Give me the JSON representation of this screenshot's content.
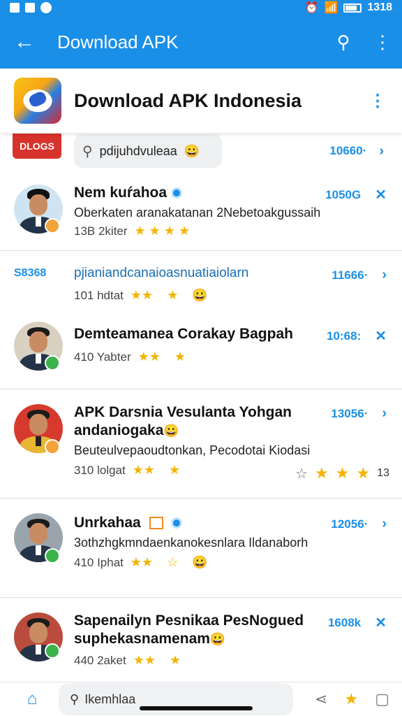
{
  "status_bar": {
    "time": "1318"
  },
  "app_bar": {
    "title": "Download APK"
  },
  "header": {
    "app_name": "Download APK Indonesia"
  },
  "search": {
    "badge": "DLOGS",
    "query": "pdijuhdvuleaa",
    "emoji": "😀",
    "time": "10660·"
  },
  "chats": [
    {
      "title": "Nem kuŕahoa",
      "time": "1050G",
      "subtitle": "Oberkaten aranakatanan 2Nebetoakgussaih",
      "meta": "13B 2kiter",
      "stars": "★ ★ ★ ★",
      "dot_color": "#f2a33a"
    },
    {
      "tag": "S8368",
      "link": "pjianiandcanaioasnuatiaiolarn",
      "time": "11666·",
      "meta": "101 hdtat",
      "stars": "★★",
      "star2": "★",
      "emoji": "😀"
    },
    {
      "title": "Demteamanea Corakay Bagpah",
      "time": "10:68:",
      "meta": "410 Yabter",
      "stars": "★★",
      "star2": "★",
      "dot_color": "#3bb34a"
    },
    {
      "title": "APK Darsnia Vesulanta Yohgan",
      "title2": "andaniogaka",
      "emoji": "😀",
      "time": "13056·",
      "subtitle": "Beuteulvepaoudtonkan, Pecodotai Kiodasi",
      "meta": "310 lolgat",
      "stars": "★★",
      "star2": "★",
      "rating_count": "13",
      "dot_color": "#f2a33a"
    },
    {
      "title": "Unrkahaa",
      "time": "12056·",
      "subtitle": "3othzhgkmndaenkanokesnlara Ildanaborh",
      "meta": "410 Iphat",
      "stars": "★★",
      "star2": "☆",
      "emoji": "😀",
      "dot_color": "#3bb34a"
    },
    {
      "title": "Sapenailyn Pesnikaa PesNogued",
      "title2": "suphekasnamenam",
      "emoji": "😀",
      "time": "1608k",
      "meta": "440 2aket",
      "stars": "★★",
      "star2": "★",
      "dot_color": "#3bb34a"
    }
  ],
  "bottom_bar": {
    "search_text": "Ikemhlaa"
  },
  "colors": {
    "primary": "#1a8fe8",
    "star": "#f4b400"
  }
}
